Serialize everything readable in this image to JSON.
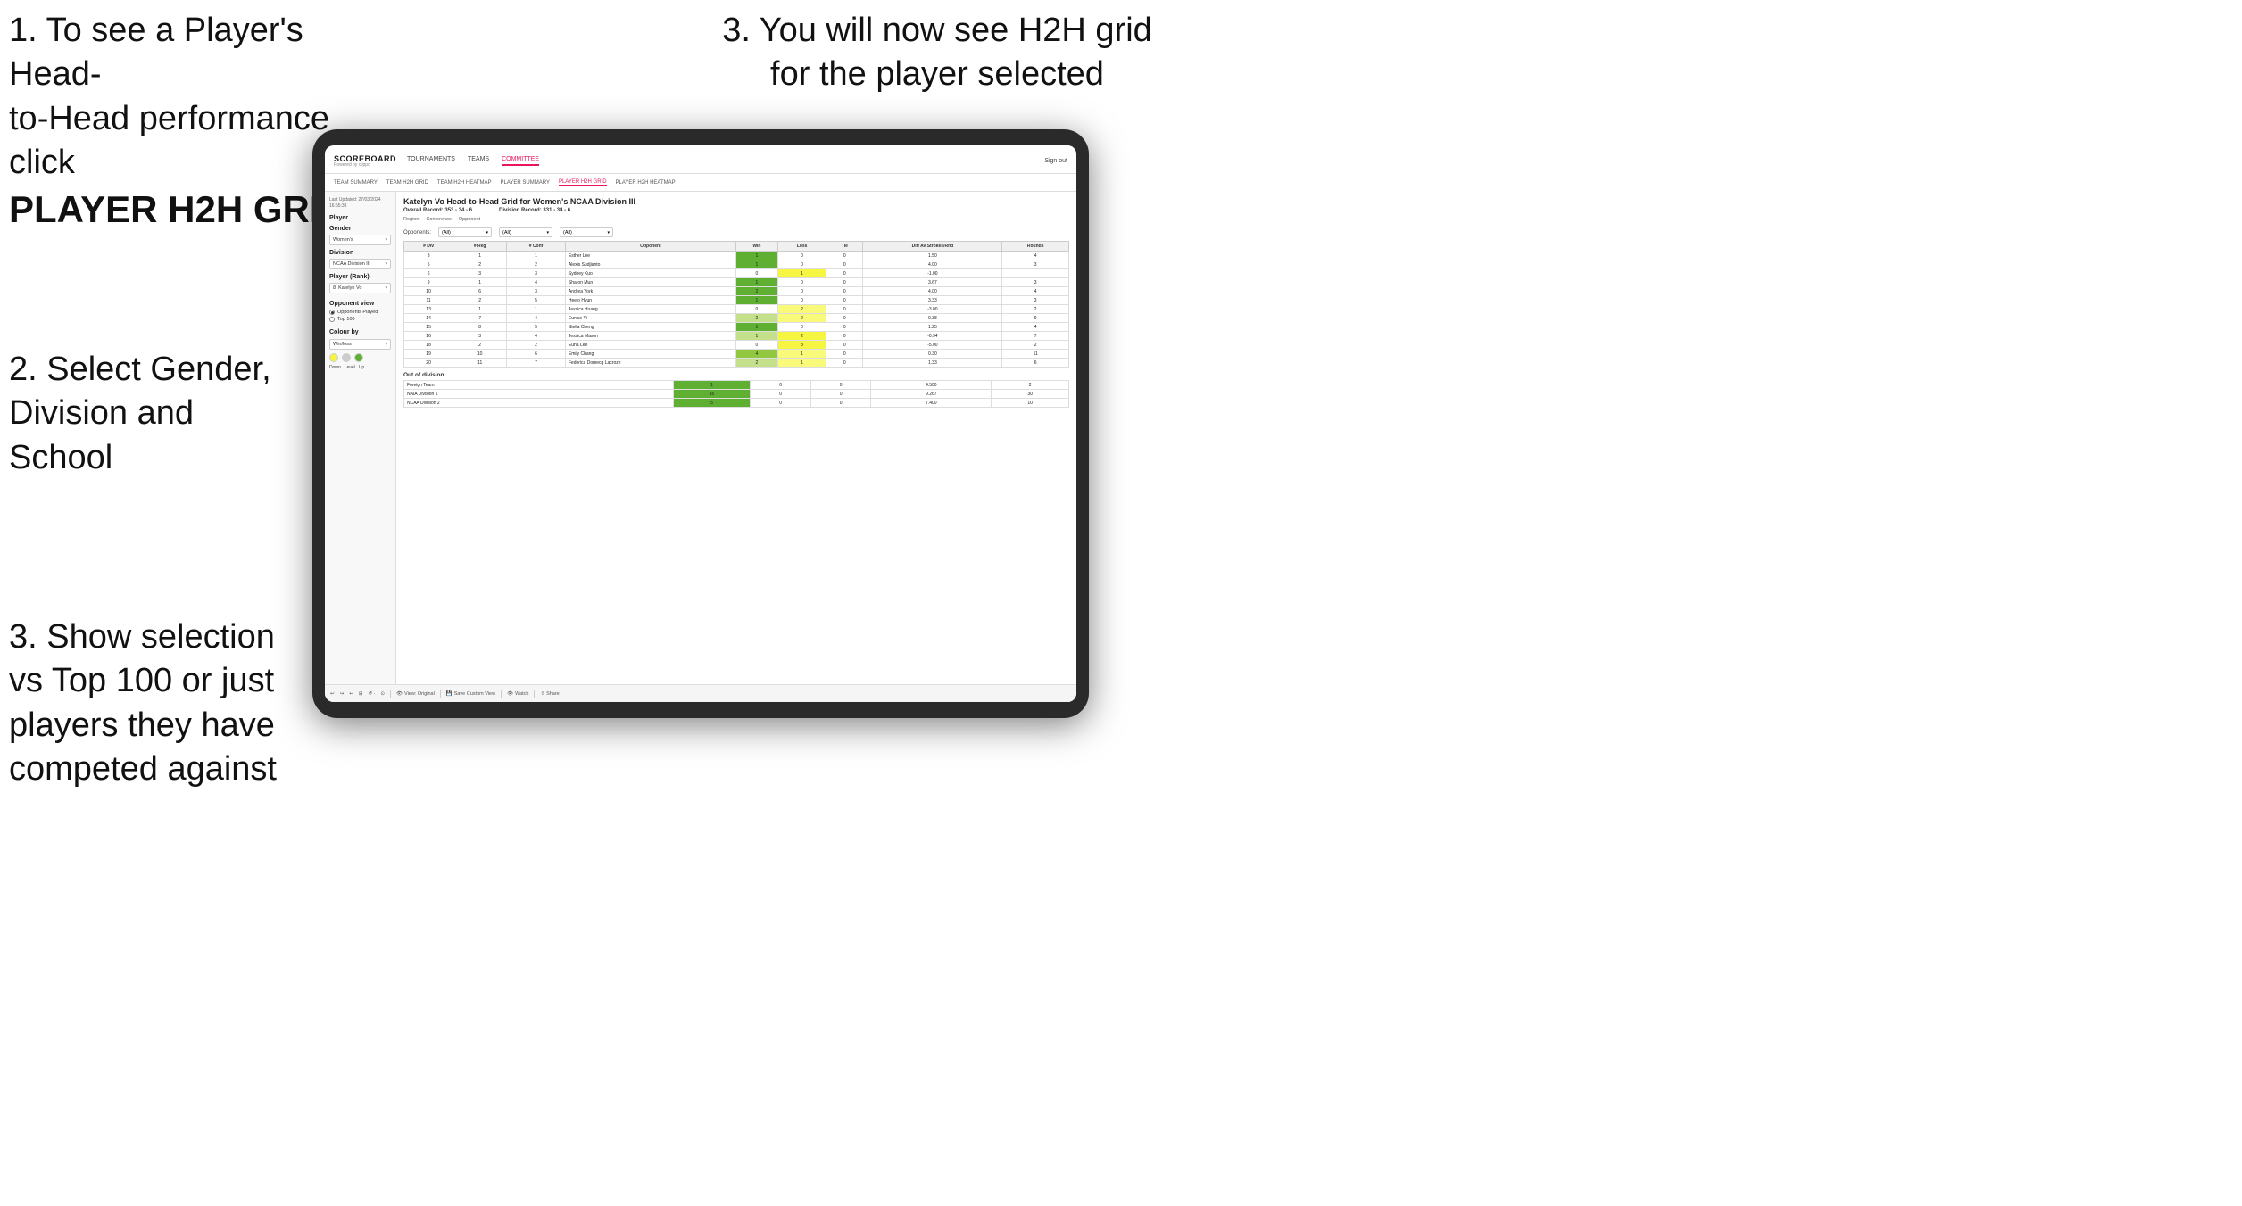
{
  "instructions": {
    "step1_line1": "1. To see a Player's Head-",
    "step1_line2": "to-Head performance click",
    "step1_bold": "PLAYER H2H GRID",
    "step2_line1": "2. Select Gender,",
    "step2_line2": "Division and",
    "step2_line3": "School",
    "step3_right_line1": "3. You will now see H2H grid",
    "step3_right_line2": "for the player selected",
    "step3_left_line1": "3. Show selection",
    "step3_left_line2": "vs Top 100 or just",
    "step3_left_line3": "players they have",
    "step3_left_line4": "competed against"
  },
  "nav": {
    "logo": "SCOREBOARD",
    "logo_sub": "Powered by clippd",
    "links": [
      "TOURNAMENTS",
      "TEAMS",
      "COMMITTEE"
    ],
    "sign_out": "Sign out"
  },
  "sub_nav": {
    "links": [
      "TEAM SUMMARY",
      "TEAM H2H GRID",
      "TEAM H2H HEATMAP",
      "PLAYER SUMMARY",
      "PLAYER H2H GRID",
      "PLAYER H2H HEATMAP"
    ]
  },
  "sidebar": {
    "timestamp_label": "Last Updated: 27/03/2024",
    "timestamp_time": "16:55:38",
    "player_label": "Player",
    "gender_label": "Gender",
    "gender_value": "Women's",
    "division_label": "Division",
    "division_value": "NCAA Division III",
    "player_rank_label": "Player (Rank)",
    "player_rank_value": "8. Katelyn Vo",
    "opponent_view_label": "Opponent view",
    "radio_opponents": "Opponents Played",
    "radio_top100": "Top 100",
    "colour_by_label": "Colour by",
    "colour_value": "Win/loss",
    "colour_down": "Down",
    "colour_level": "Level",
    "colour_up": "Up"
  },
  "grid": {
    "title": "Katelyn Vo Head-to-Head Grid for Women's NCAA Division III",
    "overall_record_label": "Overall Record:",
    "overall_record_value": "353 - 34 - 6",
    "division_record_label": "Division Record:",
    "division_record_value": "331 - 34 - 6",
    "region_label": "Region",
    "conference_label": "Conference",
    "opponent_label": "Opponent",
    "opponents_label": "Opponents:",
    "opponents_value": "(All)",
    "conference_filter": "(All)",
    "opponent_filter": "(All)",
    "col_headers": [
      "# Div",
      "# Reg",
      "# Conf",
      "Opponent",
      "Win",
      "Loss",
      "Tie",
      "Diff Av Strokes/Rnd",
      "Rounds"
    ],
    "rows": [
      {
        "div": 3,
        "reg": 1,
        "conf": 1,
        "opponent": "Esther Lee",
        "win": 1,
        "loss": 0,
        "tie": 0,
        "diff": "1.50",
        "rounds": 4,
        "win_color": "green_dark"
      },
      {
        "div": 5,
        "reg": 2,
        "conf": 2,
        "opponent": "Alexis Sudjianto",
        "win": 1,
        "loss": 0,
        "tie": 0,
        "diff": "4.00",
        "rounds": 3,
        "win_color": "green_dark"
      },
      {
        "div": 6,
        "reg": 3,
        "conf": 3,
        "opponent": "Sydney Kuo",
        "win": 0,
        "loss": 1,
        "tie": 0,
        "diff": "-1.00",
        "rounds": "",
        "win_color": "yellow"
      },
      {
        "div": 9,
        "reg": 1,
        "conf": 4,
        "opponent": "Sharon Mun",
        "win": 1,
        "loss": 0,
        "tie": 0,
        "diff": "3.67",
        "rounds": 3,
        "win_color": "green_dark"
      },
      {
        "div": 10,
        "reg": 6,
        "conf": 3,
        "opponent": "Andrea York",
        "win": 2,
        "loss": 0,
        "tie": 0,
        "diff": "4.00",
        "rounds": 4,
        "win_color": "green_dark"
      },
      {
        "div": 11,
        "reg": 2,
        "conf": 5,
        "opponent": "Heejo Hyun",
        "win": 1,
        "loss": 0,
        "tie": 0,
        "diff": "3.33",
        "rounds": 3,
        "win_color": "green_dark"
      },
      {
        "div": 13,
        "reg": 1,
        "conf": 1,
        "opponent": "Jessica Huang",
        "win": 0,
        "loss": 2,
        "tie": 0,
        "diff": "-3.00",
        "rounds": 2,
        "win_color": "yellow_light"
      },
      {
        "div": 14,
        "reg": 7,
        "conf": 4,
        "opponent": "Eunice Yi",
        "win": 2,
        "loss": 2,
        "tie": 0,
        "diff": "0.38",
        "rounds": 9,
        "win_color": "green_light"
      },
      {
        "div": 15,
        "reg": 8,
        "conf": 5,
        "opponent": "Stella Cheng",
        "win": 1,
        "loss": 0,
        "tie": 0,
        "diff": "1.25",
        "rounds": 4,
        "win_color": "green_dark"
      },
      {
        "div": 16,
        "reg": 3,
        "conf": 4,
        "opponent": "Jessica Mason",
        "win": 1,
        "loss": 2,
        "tie": 0,
        "diff": "-0.94",
        "rounds": 7,
        "win_color": "yellow"
      },
      {
        "div": 18,
        "reg": 2,
        "conf": 2,
        "opponent": "Euna Lee",
        "win": 0,
        "loss": 3,
        "tie": 0,
        "diff": "-5.00",
        "rounds": 2,
        "win_color": "yellow"
      },
      {
        "div": 19,
        "reg": 10,
        "conf": 6,
        "opponent": "Emily Chang",
        "win": 4,
        "loss": 1,
        "tie": 0,
        "diff": "0.30",
        "rounds": 11,
        "win_color": "green_mid"
      },
      {
        "div": 20,
        "reg": 11,
        "conf": 7,
        "opponent": "Federica Domecq Lacroze",
        "win": 2,
        "loss": 1,
        "tie": 0,
        "diff": "1.33",
        "rounds": 6,
        "win_color": "green_light"
      }
    ],
    "out_division_label": "Out of division",
    "out_division_rows": [
      {
        "opponent": "Foreign Team",
        "win": 1,
        "loss": 0,
        "tie": 0,
        "diff": "4.500",
        "rounds": 2
      },
      {
        "opponent": "NAIA Division 1",
        "win": 15,
        "loss": 0,
        "tie": 0,
        "diff": "9.267",
        "rounds": 30
      },
      {
        "opponent": "NCAA Division 2",
        "win": 5,
        "loss": 0,
        "tie": 0,
        "diff": "7.400",
        "rounds": 10
      }
    ]
  },
  "toolbar": {
    "view_original": "View: Original",
    "save_custom": "Save Custom View",
    "watch": "Watch",
    "share": "Share"
  }
}
